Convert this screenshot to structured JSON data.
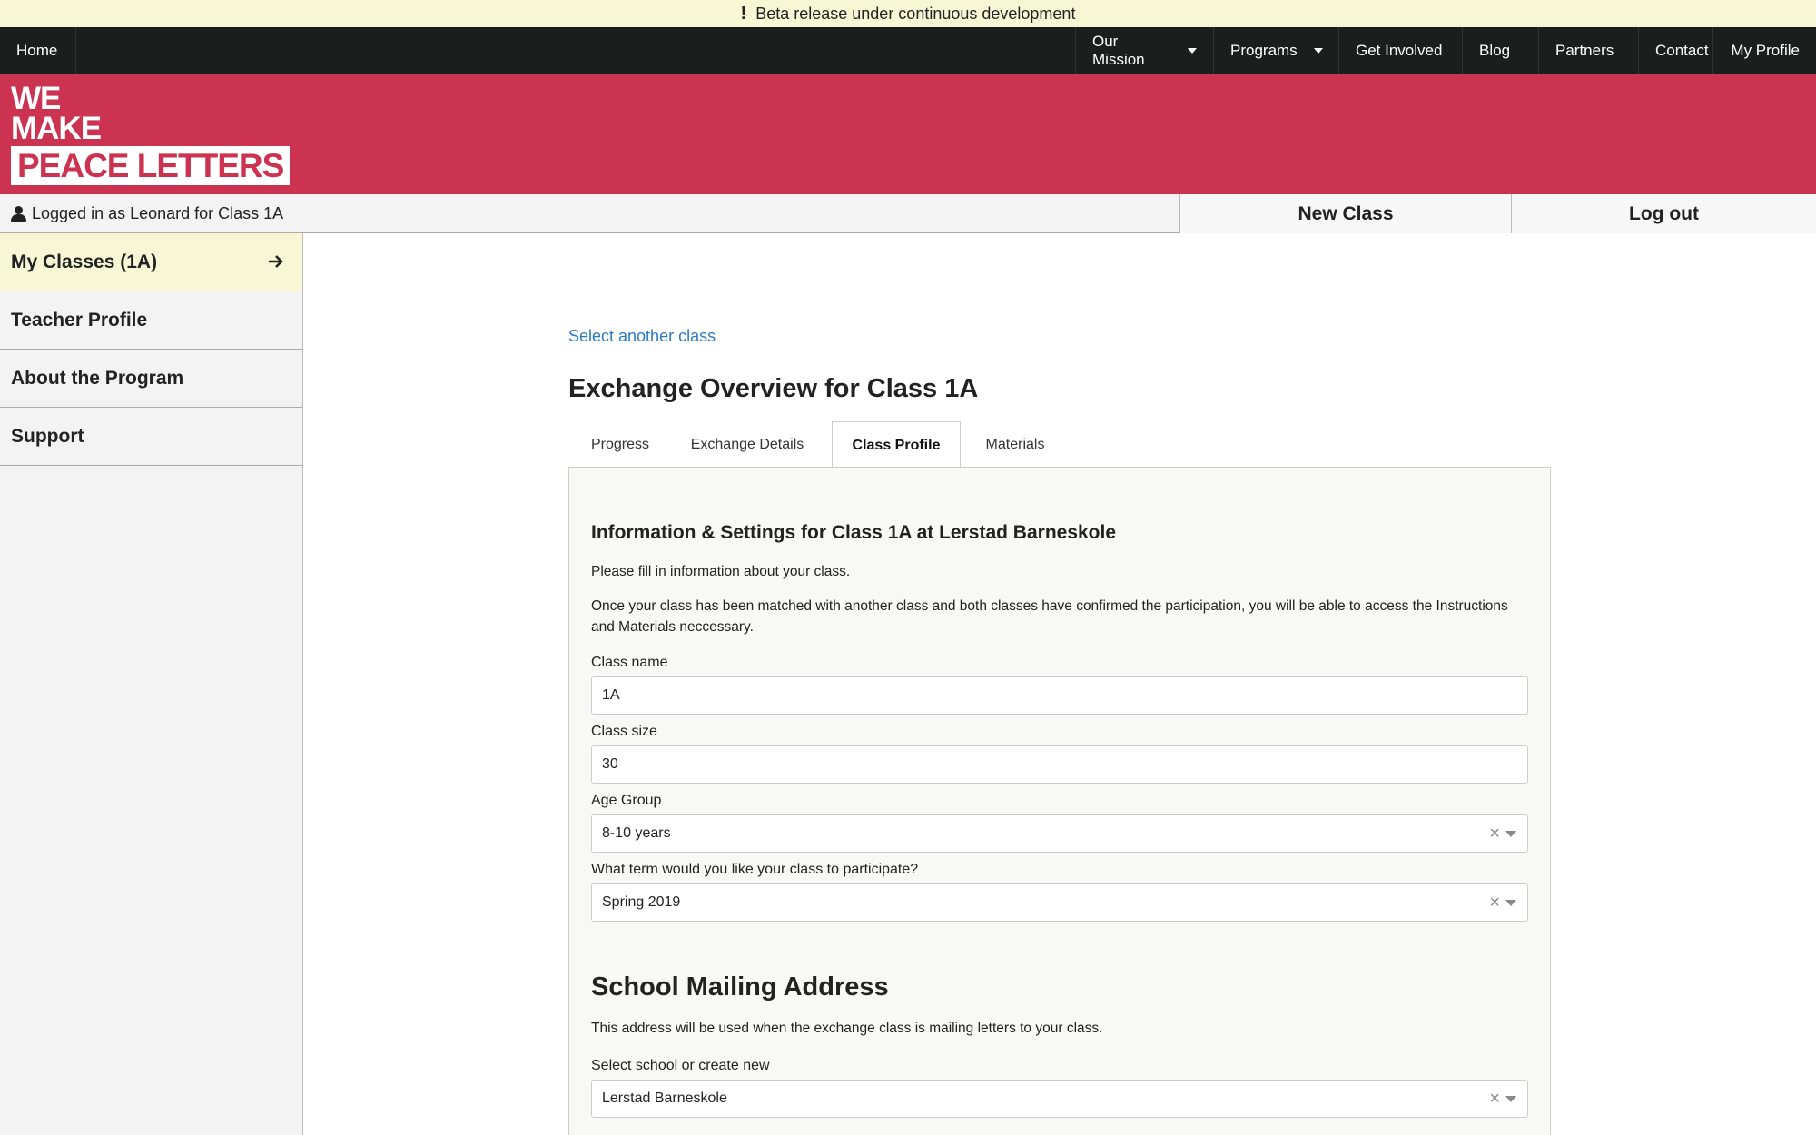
{
  "beta": {
    "icon": "exclamation-icon",
    "text": "Beta release under continuous development"
  },
  "nav": {
    "home": "Home",
    "items": [
      "Our Mission",
      "Programs",
      "Get Involved",
      "Blog",
      "Partners",
      "Contact",
      "My Profile"
    ]
  },
  "logo": {
    "line1": "WE",
    "line2": "MAKE",
    "line3": "PEACE LETTERS"
  },
  "user": {
    "icon": "user-icon",
    "logged_in": "Logged in as Leonard for Class 1A",
    "new_class": "New Class",
    "log_out": "Log out"
  },
  "sidebar": {
    "items": [
      {
        "label": "My Classes (1A)",
        "active": true,
        "icon": "arrow-right-icon"
      },
      {
        "label": "Teacher Profile"
      },
      {
        "label": "About the Program"
      },
      {
        "label": "Support"
      }
    ]
  },
  "main": {
    "select_link": "Select another class",
    "title": "Exchange Overview for Class 1A",
    "tabs": [
      "Progress",
      "Exchange Details",
      "Class Profile",
      "Materials"
    ],
    "active_tab": "Class Profile"
  },
  "profile": {
    "heading": "Information & Settings for Class 1A at Lerstad Barneskole",
    "intro": "Please fill in information about your class.",
    "note": "Once your class has been matched with another class and both classes have confirmed the participation, you will be able to access the Instructions and Materials neccessary.",
    "class_name_label": "Class name",
    "class_name_value": "1A",
    "class_size_label": "Class size",
    "class_size_value": "30",
    "age_group_label": "Age Group",
    "age_group_value": "8-10 years",
    "term_label": "What term would you like your class to participate?",
    "term_value": "Spring 2019",
    "clear_symbol": "×"
  },
  "mailing": {
    "heading": "School Mailing Address",
    "desc": "This address will be used when the exchange class is mailing letters to your class.",
    "school_label": "Select school or create new",
    "school_value": "Lerstad Barneskole"
  },
  "colors": {
    "brand": "#cc3350",
    "nav_bg": "#1c1e1e",
    "beta_bg": "#f7f7d6",
    "link": "#2b7bc4"
  }
}
